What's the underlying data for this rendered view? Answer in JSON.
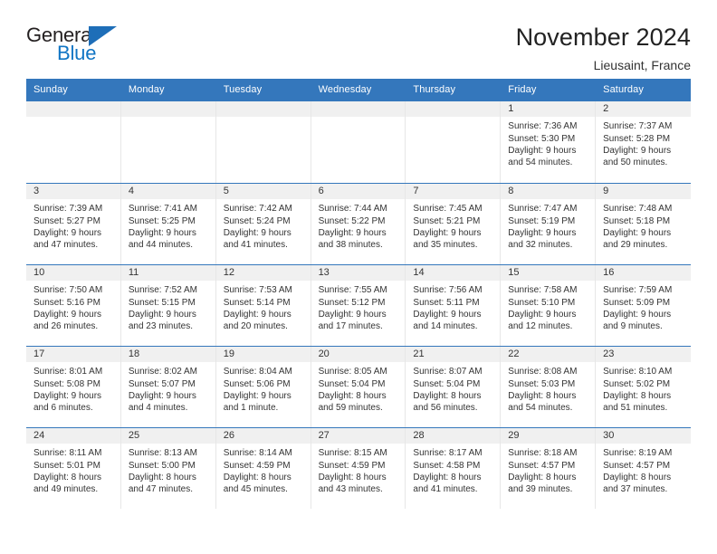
{
  "brand": {
    "name_part1": "General",
    "name_part2": "Blue",
    "accent_color": "#1175c4",
    "triangle_color": "#1e6eb8"
  },
  "header": {
    "title": "November 2024",
    "subtitle": "Lieusaint, France",
    "header_bg": "#3477bc"
  },
  "weekdays": [
    "Sunday",
    "Monday",
    "Tuesday",
    "Wednesday",
    "Thursday",
    "Friday",
    "Saturday"
  ],
  "weeks": [
    [
      {
        "day": "",
        "empty": true
      },
      {
        "day": "",
        "empty": true
      },
      {
        "day": "",
        "empty": true
      },
      {
        "day": "",
        "empty": true
      },
      {
        "day": "",
        "empty": true
      },
      {
        "day": "1",
        "sunrise": "Sunrise: 7:36 AM",
        "sunset": "Sunset: 5:30 PM",
        "daylight1": "Daylight: 9 hours",
        "daylight2": "and 54 minutes."
      },
      {
        "day": "2",
        "sunrise": "Sunrise: 7:37 AM",
        "sunset": "Sunset: 5:28 PM",
        "daylight1": "Daylight: 9 hours",
        "daylight2": "and 50 minutes."
      }
    ],
    [
      {
        "day": "3",
        "sunrise": "Sunrise: 7:39 AM",
        "sunset": "Sunset: 5:27 PM",
        "daylight1": "Daylight: 9 hours",
        "daylight2": "and 47 minutes."
      },
      {
        "day": "4",
        "sunrise": "Sunrise: 7:41 AM",
        "sunset": "Sunset: 5:25 PM",
        "daylight1": "Daylight: 9 hours",
        "daylight2": "and 44 minutes."
      },
      {
        "day": "5",
        "sunrise": "Sunrise: 7:42 AM",
        "sunset": "Sunset: 5:24 PM",
        "daylight1": "Daylight: 9 hours",
        "daylight2": "and 41 minutes."
      },
      {
        "day": "6",
        "sunrise": "Sunrise: 7:44 AM",
        "sunset": "Sunset: 5:22 PM",
        "daylight1": "Daylight: 9 hours",
        "daylight2": "and 38 minutes."
      },
      {
        "day": "7",
        "sunrise": "Sunrise: 7:45 AM",
        "sunset": "Sunset: 5:21 PM",
        "daylight1": "Daylight: 9 hours",
        "daylight2": "and 35 minutes."
      },
      {
        "day": "8",
        "sunrise": "Sunrise: 7:47 AM",
        "sunset": "Sunset: 5:19 PM",
        "daylight1": "Daylight: 9 hours",
        "daylight2": "and 32 minutes."
      },
      {
        "day": "9",
        "sunrise": "Sunrise: 7:48 AM",
        "sunset": "Sunset: 5:18 PM",
        "daylight1": "Daylight: 9 hours",
        "daylight2": "and 29 minutes."
      }
    ],
    [
      {
        "day": "10",
        "sunrise": "Sunrise: 7:50 AM",
        "sunset": "Sunset: 5:16 PM",
        "daylight1": "Daylight: 9 hours",
        "daylight2": "and 26 minutes."
      },
      {
        "day": "11",
        "sunrise": "Sunrise: 7:52 AM",
        "sunset": "Sunset: 5:15 PM",
        "daylight1": "Daylight: 9 hours",
        "daylight2": "and 23 minutes."
      },
      {
        "day": "12",
        "sunrise": "Sunrise: 7:53 AM",
        "sunset": "Sunset: 5:14 PM",
        "daylight1": "Daylight: 9 hours",
        "daylight2": "and 20 minutes."
      },
      {
        "day": "13",
        "sunrise": "Sunrise: 7:55 AM",
        "sunset": "Sunset: 5:12 PM",
        "daylight1": "Daylight: 9 hours",
        "daylight2": "and 17 minutes."
      },
      {
        "day": "14",
        "sunrise": "Sunrise: 7:56 AM",
        "sunset": "Sunset: 5:11 PM",
        "daylight1": "Daylight: 9 hours",
        "daylight2": "and 14 minutes."
      },
      {
        "day": "15",
        "sunrise": "Sunrise: 7:58 AM",
        "sunset": "Sunset: 5:10 PM",
        "daylight1": "Daylight: 9 hours",
        "daylight2": "and 12 minutes."
      },
      {
        "day": "16",
        "sunrise": "Sunrise: 7:59 AM",
        "sunset": "Sunset: 5:09 PM",
        "daylight1": "Daylight: 9 hours",
        "daylight2": "and 9 minutes."
      }
    ],
    [
      {
        "day": "17",
        "sunrise": "Sunrise: 8:01 AM",
        "sunset": "Sunset: 5:08 PM",
        "daylight1": "Daylight: 9 hours",
        "daylight2": "and 6 minutes."
      },
      {
        "day": "18",
        "sunrise": "Sunrise: 8:02 AM",
        "sunset": "Sunset: 5:07 PM",
        "daylight1": "Daylight: 9 hours",
        "daylight2": "and 4 minutes."
      },
      {
        "day": "19",
        "sunrise": "Sunrise: 8:04 AM",
        "sunset": "Sunset: 5:06 PM",
        "daylight1": "Daylight: 9 hours",
        "daylight2": "and 1 minute."
      },
      {
        "day": "20",
        "sunrise": "Sunrise: 8:05 AM",
        "sunset": "Sunset: 5:04 PM",
        "daylight1": "Daylight: 8 hours",
        "daylight2": "and 59 minutes."
      },
      {
        "day": "21",
        "sunrise": "Sunrise: 8:07 AM",
        "sunset": "Sunset: 5:04 PM",
        "daylight1": "Daylight: 8 hours",
        "daylight2": "and 56 minutes."
      },
      {
        "day": "22",
        "sunrise": "Sunrise: 8:08 AM",
        "sunset": "Sunset: 5:03 PM",
        "daylight1": "Daylight: 8 hours",
        "daylight2": "and 54 minutes."
      },
      {
        "day": "23",
        "sunrise": "Sunrise: 8:10 AM",
        "sunset": "Sunset: 5:02 PM",
        "daylight1": "Daylight: 8 hours",
        "daylight2": "and 51 minutes."
      }
    ],
    [
      {
        "day": "24",
        "sunrise": "Sunrise: 8:11 AM",
        "sunset": "Sunset: 5:01 PM",
        "daylight1": "Daylight: 8 hours",
        "daylight2": "and 49 minutes."
      },
      {
        "day": "25",
        "sunrise": "Sunrise: 8:13 AM",
        "sunset": "Sunset: 5:00 PM",
        "daylight1": "Daylight: 8 hours",
        "daylight2": "and 47 minutes."
      },
      {
        "day": "26",
        "sunrise": "Sunrise: 8:14 AM",
        "sunset": "Sunset: 4:59 PM",
        "daylight1": "Daylight: 8 hours",
        "daylight2": "and 45 minutes."
      },
      {
        "day": "27",
        "sunrise": "Sunrise: 8:15 AM",
        "sunset": "Sunset: 4:59 PM",
        "daylight1": "Daylight: 8 hours",
        "daylight2": "and 43 minutes."
      },
      {
        "day": "28",
        "sunrise": "Sunrise: 8:17 AM",
        "sunset": "Sunset: 4:58 PM",
        "daylight1": "Daylight: 8 hours",
        "daylight2": "and 41 minutes."
      },
      {
        "day": "29",
        "sunrise": "Sunrise: 8:18 AM",
        "sunset": "Sunset: 4:57 PM",
        "daylight1": "Daylight: 8 hours",
        "daylight2": "and 39 minutes."
      },
      {
        "day": "30",
        "sunrise": "Sunrise: 8:19 AM",
        "sunset": "Sunset: 4:57 PM",
        "daylight1": "Daylight: 8 hours",
        "daylight2": "and 37 minutes."
      }
    ]
  ]
}
